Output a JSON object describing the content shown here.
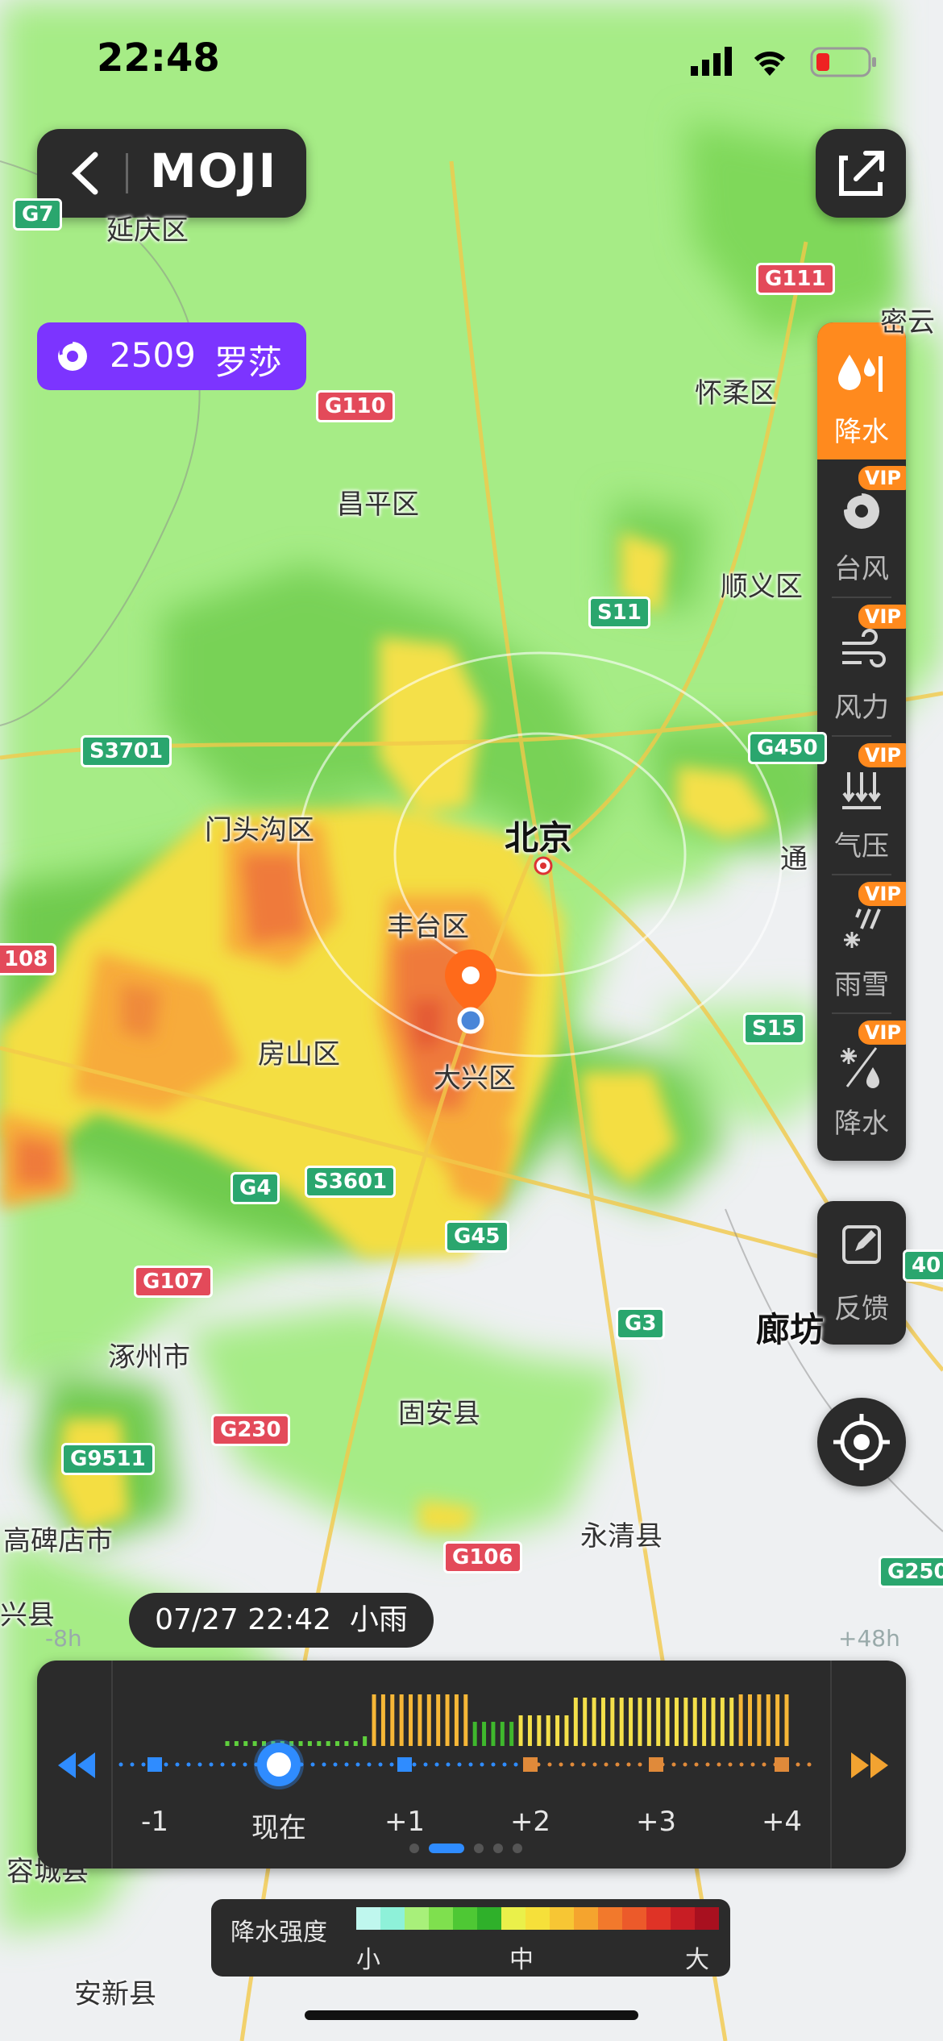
{
  "status_bar": {
    "time": "22:48"
  },
  "header": {
    "back_label": "<",
    "brand": "MOJI",
    "share_label": "share"
  },
  "typhoon": {
    "number": "2509",
    "name": "罗莎"
  },
  "side_menu": {
    "items": [
      {
        "label": "降水",
        "icon": "rain-drop-icon",
        "vip": false,
        "active": true
      },
      {
        "label": "台风",
        "icon": "typhoon-icon",
        "vip": true
      },
      {
        "label": "风力",
        "icon": "wind-icon",
        "vip": true
      },
      {
        "label": "气压",
        "icon": "pressure-icon",
        "vip": true
      },
      {
        "label": "雨雪",
        "icon": "rain-snow-icon",
        "vip": true
      },
      {
        "label": "降水",
        "icon": "precip-snow-icon",
        "vip": true
      }
    ],
    "vip_label": "VIP",
    "feedback_label": "反馈"
  },
  "map": {
    "places": [
      {
        "name": "延庆区"
      },
      {
        "name": "怀柔区"
      },
      {
        "name": "密云"
      },
      {
        "name": "昌平区"
      },
      {
        "name": "顺义区"
      },
      {
        "name": "门头沟区"
      },
      {
        "name": "北京"
      },
      {
        "name": "丰台区"
      },
      {
        "name": "大兴区"
      },
      {
        "name": "房山区"
      },
      {
        "name": "通"
      },
      {
        "name": "涿州市"
      },
      {
        "name": "廊坊"
      },
      {
        "name": "固安县"
      },
      {
        "name": "高碑店市"
      },
      {
        "name": "永清县"
      },
      {
        "name": "兴县"
      },
      {
        "name": "容城县"
      },
      {
        "name": "雄县"
      },
      {
        "name": "安新县"
      }
    ],
    "roads": [
      {
        "name": "G7"
      },
      {
        "name": "G111"
      },
      {
        "name": "G110"
      },
      {
        "name": "S11"
      },
      {
        "name": "S3701"
      },
      {
        "name": "G450"
      },
      {
        "name": "108"
      },
      {
        "name": "S15"
      },
      {
        "name": "G4"
      },
      {
        "name": "S3601"
      },
      {
        "name": "G45"
      },
      {
        "name": "G107"
      },
      {
        "name": "G3"
      },
      {
        "name": "G230"
      },
      {
        "name": "G9511"
      },
      {
        "name": "G106"
      },
      {
        "name": "G250"
      },
      {
        "name": "40"
      }
    ]
  },
  "timeline": {
    "current_info": "07/27 22:42  小雨",
    "left_hint": "-8h",
    "right_hint": "+48h",
    "ticks": [
      "-1",
      "现在",
      "+1",
      "+2",
      "+3",
      "+4"
    ],
    "bars": [
      1,
      1,
      1,
      1,
      1,
      1,
      1,
      1,
      1,
      1,
      1,
      1,
      1,
      1,
      1,
      2,
      6,
      6,
      6,
      6,
      6,
      6,
      6,
      6,
      6,
      6,
      6,
      3,
      3,
      3,
      3,
      3,
      4,
      4,
      4,
      4,
      4,
      4,
      5,
      5,
      5,
      5,
      5,
      5,
      5,
      5,
      5,
      5,
      5,
      5,
      5,
      5,
      5,
      5,
      5,
      5,
      6,
      6,
      6,
      6,
      6,
      6
    ],
    "page_dots": 5,
    "active_dot": 1
  },
  "legend": {
    "title": "降水强度",
    "low": "小",
    "mid": "中",
    "high": "大",
    "colors": [
      "#bff7ee",
      "#8ef1d9",
      "#a8f07a",
      "#7fe04e",
      "#4ec834",
      "#2fb02a",
      "#eaf04a",
      "#f6e03a",
      "#f7c634",
      "#f5a42e",
      "#f2792c",
      "#ec5a2a",
      "#df3326",
      "#c81d24",
      "#a8101f"
    ]
  }
}
